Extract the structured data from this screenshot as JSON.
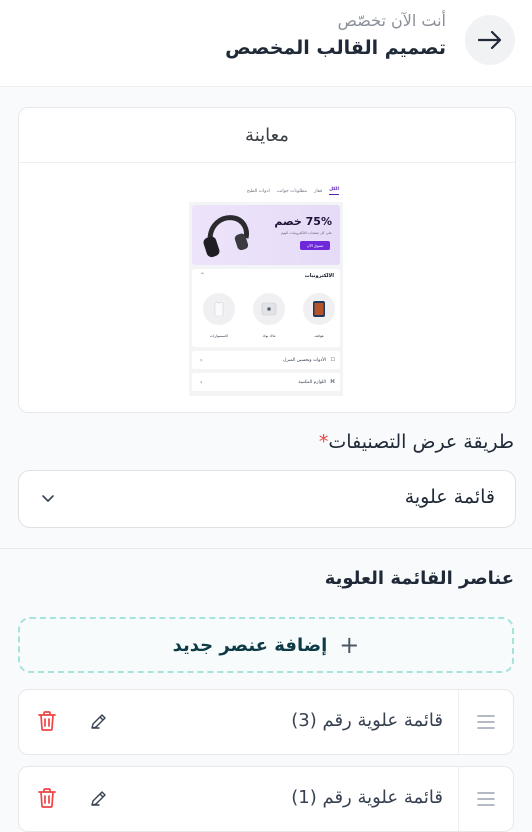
{
  "header": {
    "subtitle": "أنت الآن تخصّص",
    "title": "تصميم القالب المخصص"
  },
  "preview": {
    "heading": "معاينة",
    "tabs": [
      "الكل",
      "قفاز",
      "بنطلونات جوانب",
      "ادوات الطبخ"
    ],
    "banner": {
      "title": "75% خصم",
      "subtitle": "على كل منتجات الالكترونيات اليوم",
      "cta": "تسوق الآن"
    },
    "category_title": "الالكترونيات",
    "categories": [
      "هواتف",
      "ماك بوك",
      "اكسسوارات"
    ],
    "rows": [
      "الأدوات وتحسين المنزل",
      "اللوازم المكتبية"
    ]
  },
  "display_field": {
    "label": "طريقة عرض التصنيفات",
    "required_mark": "*",
    "value": "قائمة علوية"
  },
  "menu_section": {
    "title": "عناصر القائمة العلوية",
    "add_label": "إضافة عنصر جديد",
    "items": [
      {
        "label": "قائمة علوية رقم (3)"
      },
      {
        "label": "قائمة علوية رقم (1)"
      }
    ]
  },
  "colors": {
    "accent": "#6d28d9",
    "danger": "#ef4444",
    "add_border": "#a7e3dd"
  }
}
